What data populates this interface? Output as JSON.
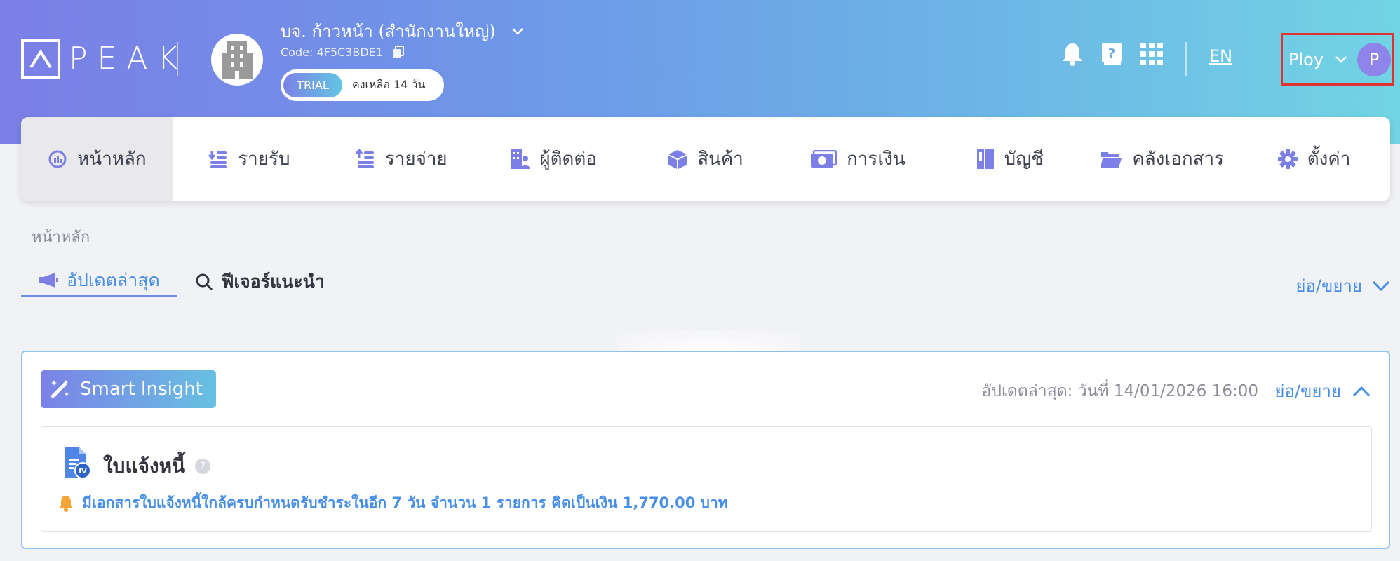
{
  "header": {
    "logo_text": "PEAK",
    "company_name": "บจ. ก้าวหน้า (สำนักงานใหญ่)",
    "company_code": "Code: 4F5C3BDE1",
    "trial_badge": "TRIAL",
    "trial_remaining": "คงเหลือ 14 วัน",
    "language": "EN",
    "user_name": "Ploy",
    "user_initial": "P",
    "icons": [
      "bell-icon",
      "help-book-icon",
      "apps-grid-icon"
    ]
  },
  "nav": {
    "items": [
      {
        "label": "หน้าหลัก",
        "icon": "dashboard-icon"
      },
      {
        "label": "รายรับ",
        "icon": "income-icon"
      },
      {
        "label": "รายจ่าย",
        "icon": "expense-icon"
      },
      {
        "label": "ผู้ติดต่อ",
        "icon": "contacts-icon"
      },
      {
        "label": "สินค้า",
        "icon": "product-box-icon"
      },
      {
        "label": "การเงิน",
        "icon": "money-icon"
      },
      {
        "label": "บัญชี",
        "icon": "ledger-icon"
      },
      {
        "label": "คลังเอกสาร",
        "icon": "folder-icon"
      },
      {
        "label": "ตั้งค่า",
        "icon": "gear-icon"
      }
    ],
    "active_index": 0
  },
  "breadcrumb": "หน้าหลัก",
  "tabs": {
    "latest_label": "อัปเดตล่าสุด",
    "features_label": "ฟีเจอร์แนะนำ",
    "collapse_label": "ย่อ/ขยาย"
  },
  "insight": {
    "badge_label": "Smart Insight",
    "updated_text": "อัปเดตล่าสุด: วันที่ 14/01/2026 16:00",
    "toggle_label": "ย่อ/ขยาย",
    "invoice_title": "ใบแจ้งหนี้",
    "invoice_help": "?",
    "invoice_icon_badge": "IV",
    "invoice_message": "มีเอกสารใบแจ้งหนี้ใกล้ครบกำหนดรับชำระในอีก 7 วัน จำนวน 1 รายการ คิดเป็นเงิน 1,770.00 บาท"
  },
  "colors": {
    "accent": "#4a8fe6",
    "highlight_border": "#e0332f",
    "bell_warning": "#f4a536"
  }
}
